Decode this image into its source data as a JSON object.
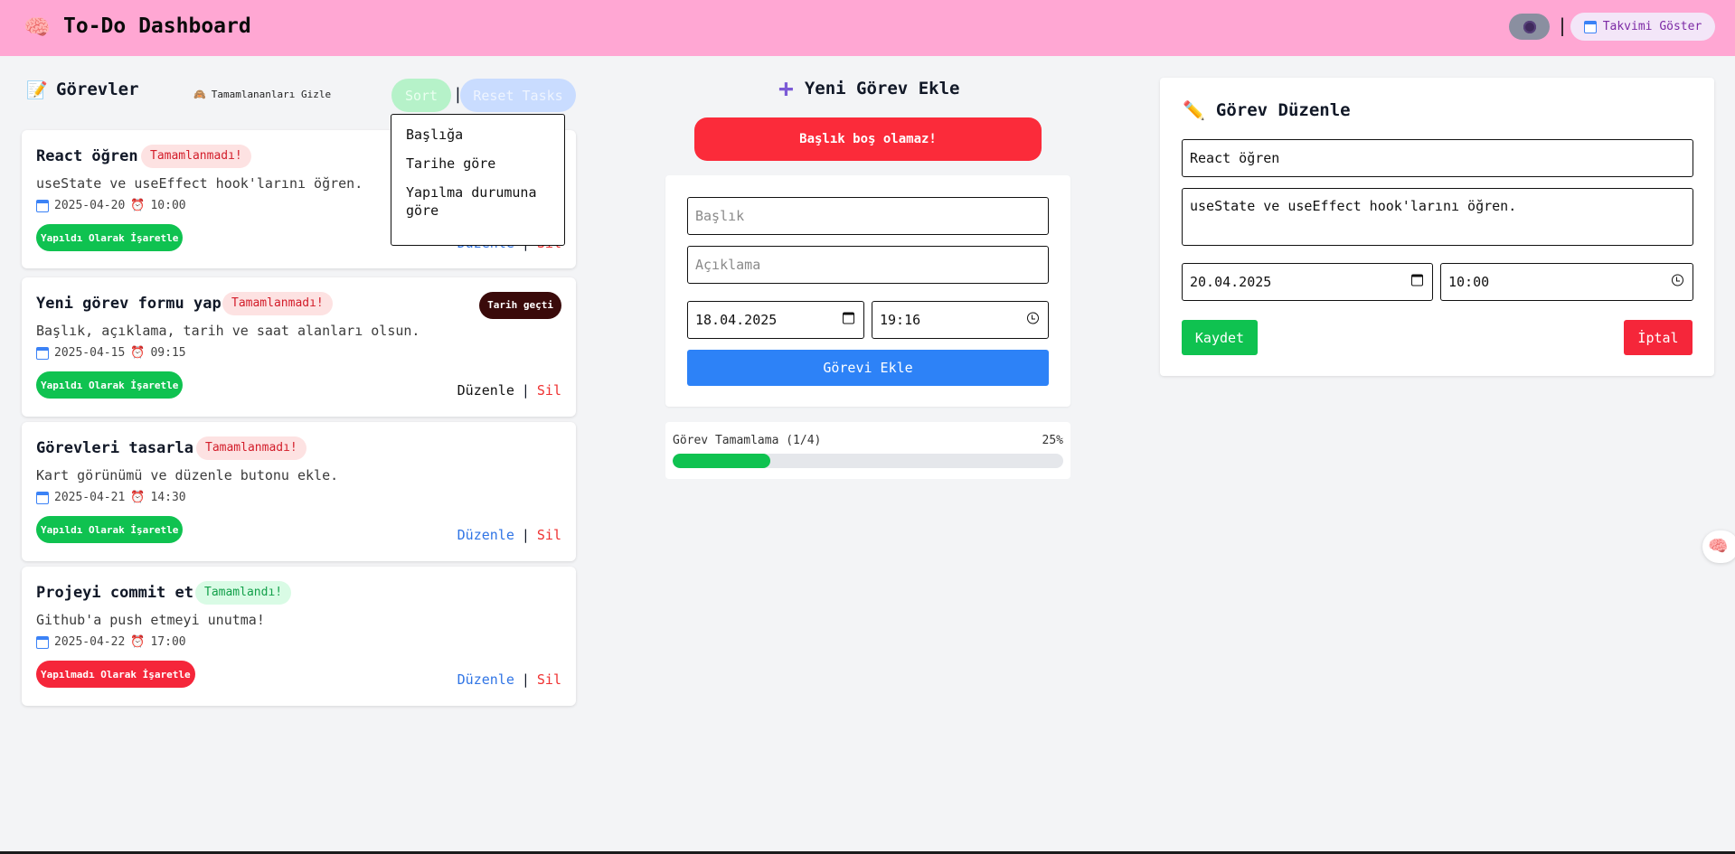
{
  "header": {
    "brand_icon": "🧠",
    "title": "To-Do Dashboard",
    "theme_toggle_icon": "moon-icon",
    "separator": "|",
    "calendar_button": "Takvimi Göster"
  },
  "tasks_panel": {
    "heading_icon": "📝",
    "heading": "Görevler",
    "hide_completed_icon": "🙈",
    "hide_completed": "Tamamlananları Gizle",
    "sort_button": "Sort",
    "separator": "|",
    "reset_button": "Reset Tasks",
    "sort_options": [
      "Başlığa",
      "Tarihe göre",
      "Yapılma durumuna göre"
    ]
  },
  "tasks": [
    {
      "title": "React öğren",
      "status": "Tamamlanmadı!",
      "description": "useState ve useEffect hook'larını öğren.",
      "date": "2025-04-20",
      "time": "10:00",
      "toggle_label": "Yapıldı Olarak İşaretle",
      "edit_label": "Düzenle",
      "delete_label": "Sil",
      "separator": "|"
    },
    {
      "title": "Yeni görev formu yap",
      "status": "Tamamlanmadı!",
      "overdue": "Tarih geçti",
      "description": "Başlık, açıklama, tarih ve saat alanları olsun.",
      "date": "2025-04-15",
      "time": "09:15",
      "toggle_label": "Yapıldı Olarak İşaretle",
      "edit_label": "Düzenle",
      "delete_label": "Sil",
      "separator": "|"
    },
    {
      "title": "Görevleri tasarla",
      "status": "Tamamlanmadı!",
      "description": "Kart görünümü ve düzenle butonu ekle.",
      "date": "2025-04-21",
      "time": "14:30",
      "toggle_label": "Yapıldı Olarak İşaretle",
      "edit_label": "Düzenle",
      "delete_label": "Sil",
      "separator": "|"
    },
    {
      "title": "Projeyi commit et",
      "status": "Tamamlandı!",
      "description": "Github'a push etmeyi unutma!",
      "date": "2025-04-22",
      "time": "17:00",
      "toggle_label": "Yapılmadı Olarak İşaretle",
      "edit_label": "Düzenle",
      "delete_label": "Sil",
      "separator": "|"
    }
  ],
  "new_task": {
    "heading": "Yeni Görev Ekle",
    "error": "Başlık boş olamaz!",
    "title_placeholder": "Başlık",
    "description_placeholder": "Açıklama",
    "date_value": "18.04.2025",
    "time_value": "19:16",
    "submit_label": "Görevi Ekle"
  },
  "progress": {
    "label": "Görev Tamamlama (1/4)",
    "percent_text": "25%",
    "fraction": 0.25
  },
  "edit_task": {
    "heading": "Görev Düzenle",
    "title_value": "React öğren",
    "description_value": "useState ve useEffect hook'larını öğren.",
    "date_value": "20.04.2025",
    "time_value": "10:00",
    "save_label": "Kaydet",
    "cancel_label": "İptal"
  },
  "floating_button_icon": "🧠",
  "colors": {
    "header_bg": "#ffa7d3",
    "success": "#0fc250",
    "danger": "#f5263a",
    "primary": "#2d82f7"
  }
}
